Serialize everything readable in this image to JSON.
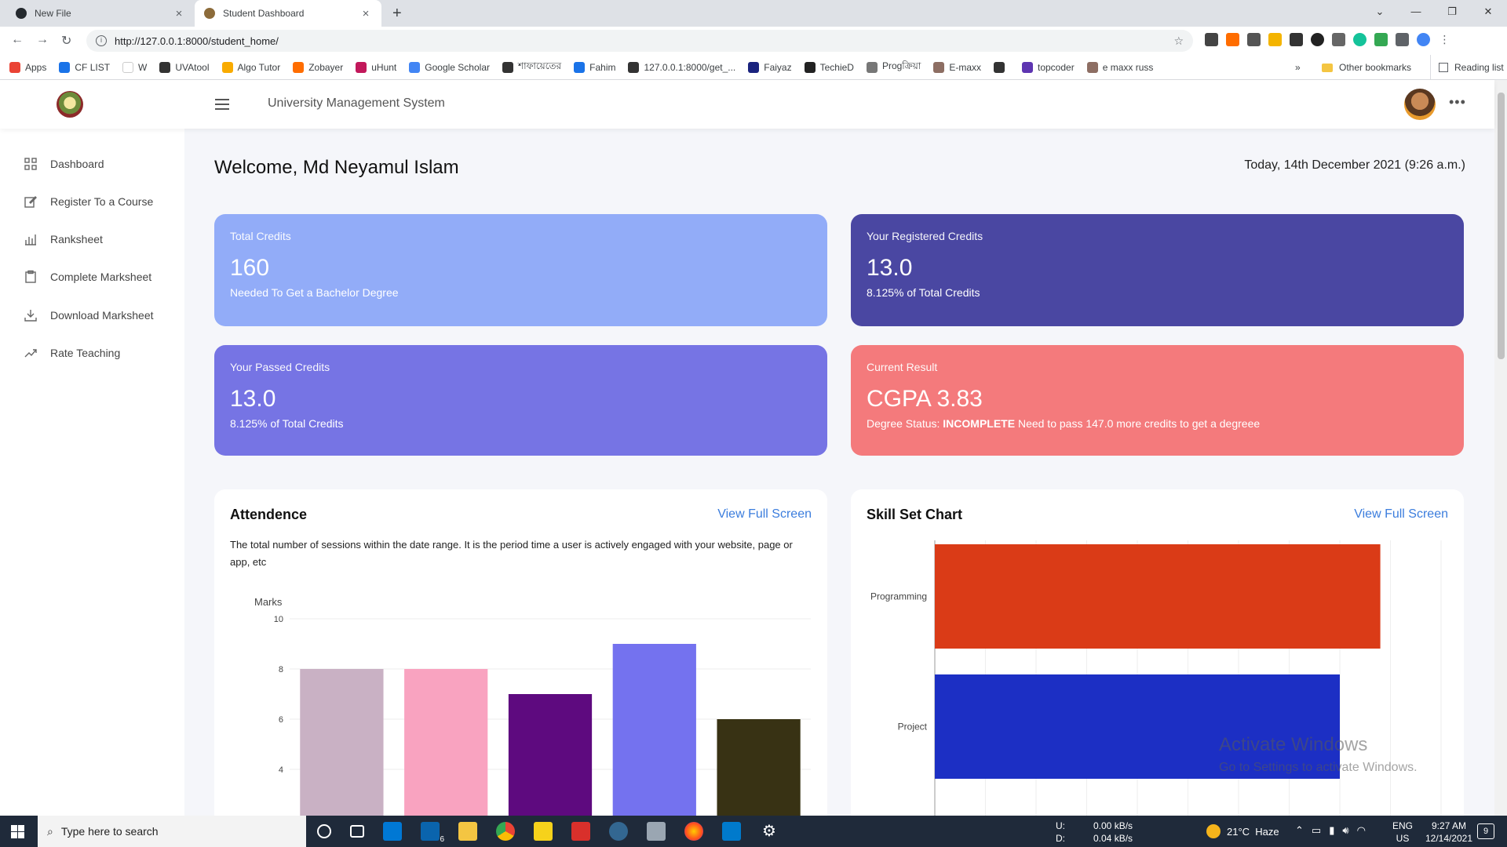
{
  "browser": {
    "tabs": [
      {
        "title": "New File",
        "active": false,
        "icon": "github-icon"
      },
      {
        "title": "Student Dashboard",
        "active": true,
        "icon": "university-logo-icon"
      }
    ],
    "url": "http://127.0.0.1:8000/student_home/",
    "bookmarks": [
      {
        "label": "Apps",
        "color": "#ea4335"
      },
      {
        "label": "CF LIST",
        "color": "#1a73e8"
      },
      {
        "label": "W",
        "color": "#ffffff"
      },
      {
        "label": "UVAtool",
        "color": "#333333"
      },
      {
        "label": "Algo Tutor",
        "color": "#f9ab00"
      },
      {
        "label": "Zobayer",
        "color": "#ff6d00"
      },
      {
        "label": "uHunt",
        "color": "#c2185b"
      },
      {
        "label": "Google Scholar",
        "color": "#4285f4"
      },
      {
        "label": "শাফায়েতের",
        "color": "#333333"
      },
      {
        "label": "Fahim",
        "color": "#1a73e8"
      },
      {
        "label": "127.0.0.1:8000/get_...",
        "color": "#333333"
      },
      {
        "label": "Faiyaz",
        "color": "#1a237e"
      },
      {
        "label": "TechieD",
        "color": "#222222"
      },
      {
        "label": "Progক্রিয়া",
        "color": "#777777"
      },
      {
        "label": "E-maxx",
        "color": "#8d6e63"
      },
      {
        "label": "",
        "color": "#333333"
      },
      {
        "label": "topcoder",
        "color": "#5e35b1"
      },
      {
        "label": "e maxx russ",
        "color": "#8d6e63"
      }
    ],
    "bookmarks_overflow": "»",
    "other_bookmarks": "Other bookmarks",
    "reading_list": "Reading list"
  },
  "header": {
    "title": "University Management System"
  },
  "sidebar": {
    "items": [
      {
        "label": "Dashboard",
        "icon": "grid-icon"
      },
      {
        "label": "Register To a Course",
        "icon": "edit-icon"
      },
      {
        "label": "Ranksheet",
        "icon": "bar-chart-icon"
      },
      {
        "label": "Complete Marksheet",
        "icon": "clipboard-icon"
      },
      {
        "label": "Download Marksheet",
        "icon": "download-icon"
      },
      {
        "label": "Rate Teaching",
        "icon": "trending-up-icon"
      }
    ]
  },
  "main": {
    "welcome": "Welcome, Md Neyamul Islam",
    "today": "Today, 14th December 2021 (9:26 a.m.)",
    "cards": [
      {
        "label": "Total Credits",
        "value": "160",
        "sub": "Needed To Get a Bachelor Degree",
        "color": "#92acf8"
      },
      {
        "label": "Your Registered Credits",
        "value": "13.0",
        "sub": "8.125% of Total Credits",
        "color": "#4a47a2"
      },
      {
        "label": "Your Passed Credits",
        "value": "13.0",
        "sub": "8.125% of Total Credits",
        "color": "#7674e4"
      },
      {
        "label": "Current Result",
        "value": "CGPA 3.83",
        "sub_prefix": "Degree Status: ",
        "sub_status": "INCOMPLETE",
        "sub_suffix": " Need to pass 147.0 more credits to get a degreee",
        "color": "#f47a7c"
      }
    ],
    "attendance": {
      "title": "Attendence",
      "link": "View Full Screen",
      "description": "The total number of sessions within the date range. It is the period time a user is actively engaged with your website, page or app, etc"
    },
    "skills": {
      "title": "Skill Set Chart",
      "link": "View Full Screen"
    }
  },
  "chart_data": [
    {
      "type": "bar",
      "ylabel": "Marks",
      "ylim": [
        0,
        10
      ],
      "yticks": [
        "10",
        "8",
        "6",
        "4"
      ],
      "values": [
        8,
        8,
        7,
        9,
        6
      ],
      "colors": [
        "#c9b1c4",
        "#f9a3c0",
        "#5e0a7f",
        "#7472ef",
        "#383214"
      ],
      "grid": true
    },
    {
      "type": "bar",
      "orientation": "horizontal",
      "categories": [
        "Programming",
        "Project"
      ],
      "values": [
        8.8,
        8.0
      ],
      "colors": [
        "#da3b17",
        "#1c2fc4"
      ],
      "xlim": [
        0,
        10
      ],
      "xticks": [
        "0",
        "1",
        "2",
        "3",
        "4",
        "5",
        "6",
        "7",
        "8",
        "9",
        "10"
      ],
      "grid": true
    }
  ],
  "watermark": {
    "line1": "Activate Windows",
    "line2": "Go to Settings to activate Windows."
  },
  "taskbar": {
    "search_placeholder": "Type here to search",
    "mail_badge": "6",
    "net_up_label": "U:",
    "net_up": "0.00 kB/s",
    "net_down_label": "D:",
    "net_down": "0.04 kB/s",
    "weather": "21°C  Haze",
    "lang": "ENG",
    "region": "US",
    "time": "9:27 AM",
    "date": "12/14/2021",
    "notif_count": "9"
  }
}
